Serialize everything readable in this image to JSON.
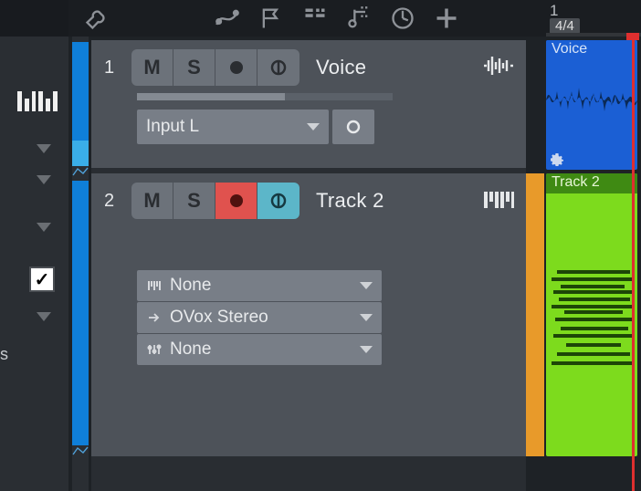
{
  "toolbar": {
    "bar_position": "1",
    "time_signature": "4/4"
  },
  "tracks": [
    {
      "number": "1",
      "name": "Voice",
      "mute_label": "M",
      "solo_label": "S",
      "armed": false,
      "monitor_on": false,
      "input_label": "Input L"
    },
    {
      "number": "2",
      "name": "Track 2",
      "mute_label": "M",
      "solo_label": "S",
      "armed": true,
      "monitor_on": true,
      "slots": {
        "instrument": "None",
        "midi_fx": "OVox Stereo",
        "audio_fx": "None"
      }
    }
  ],
  "clips": {
    "voice_label": "Voice",
    "track2_label": "Track 2"
  }
}
